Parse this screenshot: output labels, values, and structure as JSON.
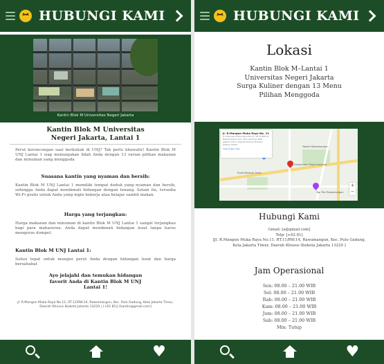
{
  "left": {
    "header_title": "HUBUNGI KAMI",
    "hero_caption": "Kantin Blok M Universitas Negeri Jakarta",
    "heading": "Kantin Blok M Universitas Negeri Jakarta, Lantai 1",
    "intro": "Perut keroncongan saat berkuliah di UNJ? Tak perlu khawatir! Kantin Blok M UNJ Lantai 1 siap memanjakan lidah Anda dengan 13 varian pilihan makanan dan minuman yang menggoda",
    "section1_title": "Suasana kantin yang nyaman dan bersih:",
    "section1_text": "Kantin Blok M UNJ Lantai 1 memiliki tempat duduk yang nyaman dan bersih, sehingga Anda dapat menikmati hidangan dengan tenang. Selain itu, tersedia Wi-Fi gratis untuk Anda yang ingin bekerja atau belajar sambil makan.",
    "section2_title": "Harga yang terjangkau:",
    "section2_text": "Harga makanan dan minuman di kantin Blok M UNJ Lantai 1 sangat terjangkau bagi para mahasiswa. Anda dapat menikmati hidangan lezat tanpa harus menguras dompet.",
    "section3_title": "Kantin Blok M UNJ Lantai 1:",
    "section3_text": "Solusi tepat untuk mengisi perut Anda dengan hidangan lezat dan harga bersahabat",
    "invite": "Ayo jelajahi dan temukan hidangan favorit Anda di Kantin Blok M UNJ Lantai 1!",
    "address": "Jl. R.Mangun Muka Raya No.11, RT.11/RW.14, Rawamangun, Kec. Pulo Gadung, Kota Jakarta Timur, Daerah Khusus Ibukota Jakarta 13220 | (+62 81)| [kantin@gmail.com]"
  },
  "right": {
    "header_title": "HUBUNGI KAMI",
    "location_title": "Lokasi",
    "location_lines": "Kantin Blok M–Lantai 1\nUniversitas Negeri Jakarta\nSurga Kuliner dengan 13 Menu\nPilihan Menggoda",
    "map": {
      "card_title": "Jl. R.Mangun Muka Raya No. 11",
      "card_body": "Jl. R.Mangun Muka Raya No.11, RT.11/RW.14, Rawamangun, Kec. Pulo Gadung, Kota Jakarta Timur, Daerah Khusus Ibukota Jakarta 13220",
      "card_link": "View larger map",
      "place_label_1": "Pusat Belanja Arion",
      "place_label_2": "Universitas Negeri Jakarta",
      "place_label_3": "Taman Rawamangun",
      "place_label_4": "Top Tier Rawamangun"
    },
    "contact_title": "Hubungi Kami",
    "contact_lines": "Gmail: [a@gmail.com]\nTelp: [+62 81]\n[Jl. R.Mangun Muka Raya No.11, RT.11/RW.14, Rawamangun, Kec. Pulo Gadung, Kota Jakarta Timur, Daerah Khusus Ibukota Jakarta 13220 ]",
    "hours_title": "Jam Operasional",
    "hours": [
      "Sen: 08.00 – 21.00 WIB",
      "Sel: 08.00 – 21.00 WIB",
      "Rab: 08.00 – 21.00 WIB",
      "Kam: 08.00 – 21.00 WIB",
      "Jum: 08.00 – 21.00 WIB",
      "Sab: 08.00 – 21.00 WIB",
      "Min: Tutup"
    ]
  },
  "icons": {
    "menu": "menu-icon",
    "logo": "smiley-logo-icon",
    "next": "chevron-right-icon",
    "search": "search-icon",
    "home": "home-icon",
    "favorite": "heart-icon"
  },
  "colors": {
    "primary": "#1c4d26",
    "logo": "#f2c21b",
    "text": "#2a2a2a"
  }
}
